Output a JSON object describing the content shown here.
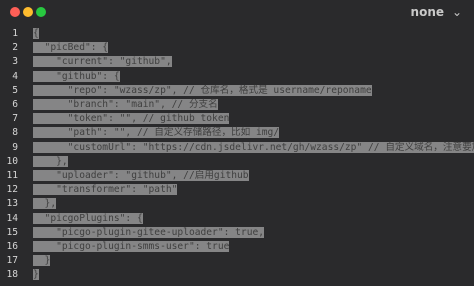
{
  "window": {
    "language_label": "none",
    "chevron": "⌄"
  },
  "editor": {
    "lines": [
      {
        "n": "1",
        "text": "{"
      },
      {
        "n": "2",
        "text": "  \"picBed\": {"
      },
      {
        "n": "3",
        "text": "    \"current\": \"github\","
      },
      {
        "n": "4",
        "text": "    \"github\": {"
      },
      {
        "n": "5",
        "text": "      \"repo\": \"wzass/zp\", // 仓库名，格式是 username/reponame"
      },
      {
        "n": "6",
        "text": "      \"branch\": \"main\", // 分支名"
      },
      {
        "n": "7",
        "text": "      \"token\": \"\", // github token"
      },
      {
        "n": "8",
        "text": "      \"path\": \"\", // 自定义存储路径，比如 img/"
      },
      {
        "n": "9",
        "text": "      \"customUrl\": \"https://cdn.jsdelivr.net/gh/wzass/zp\" // 自定义域名，注意要加 ht"
      },
      {
        "n": "10",
        "text": "    },"
      },
      {
        "n": "11",
        "text": "    \"uploader\": \"github\", //启用github"
      },
      {
        "n": "12",
        "text": "    \"transformer\": \"path\""
      },
      {
        "n": "13",
        "text": "  },"
      },
      {
        "n": "14",
        "text": "  \"picgoPlugins\": {"
      },
      {
        "n": "15",
        "text": "    \"picgo-plugin-gitee-uploader\": true,"
      },
      {
        "n": "16",
        "text": "    \"picgo-plugin-smms-user\": true"
      },
      {
        "n": "17",
        "text": "  }"
      },
      {
        "n": "18",
        "text": "}"
      }
    ]
  }
}
